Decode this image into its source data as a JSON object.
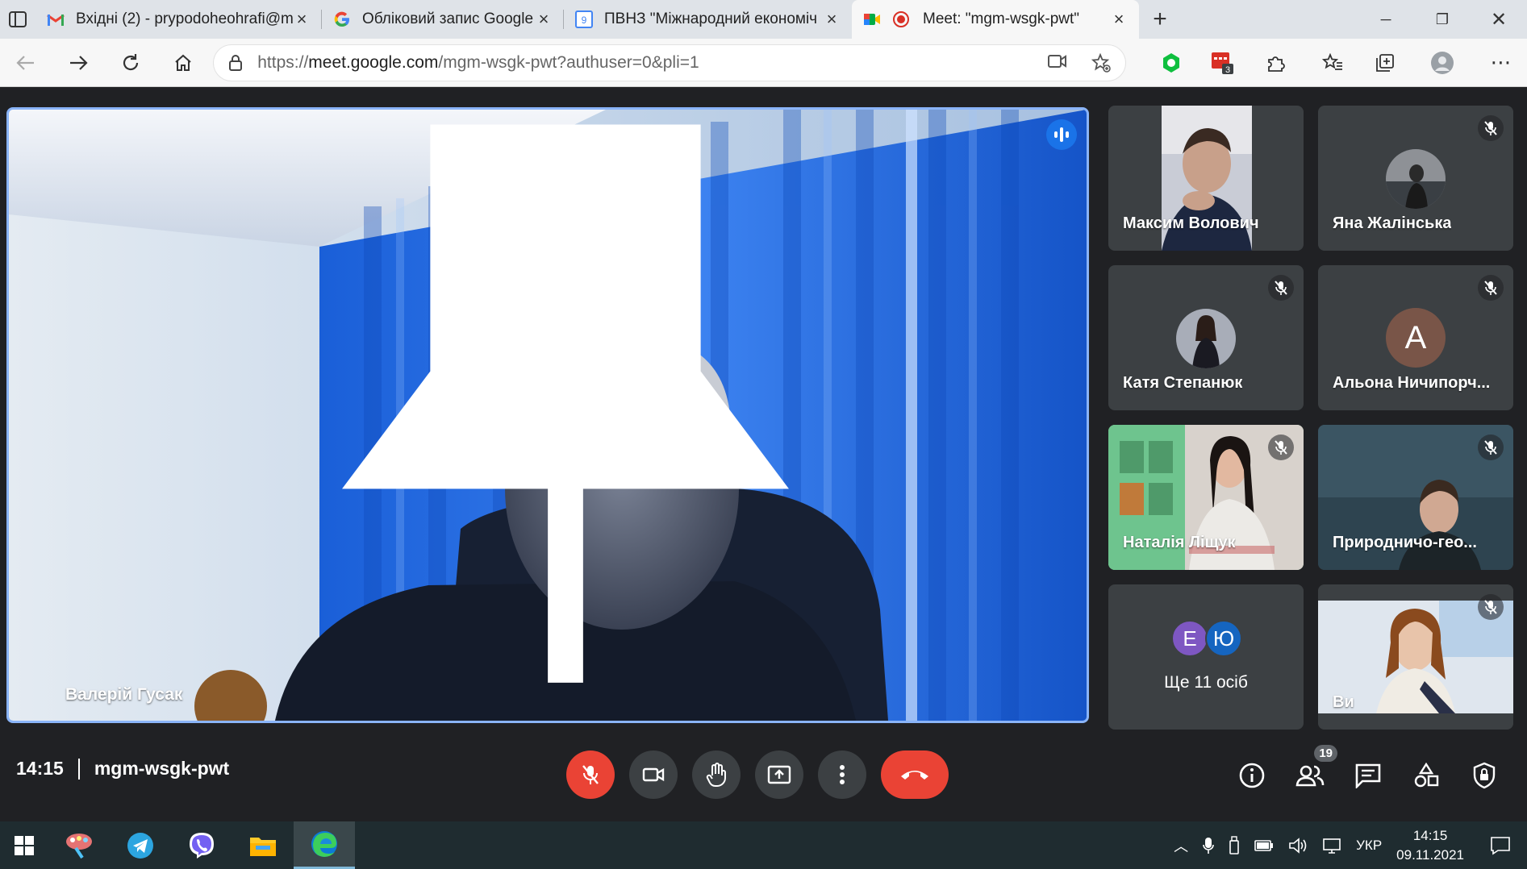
{
  "tabs": [
    {
      "title": "Вхідні (2) - prypodoheohrafi@m",
      "icon": "gmail-icon"
    },
    {
      "title": "Обліковий запис Google",
      "icon": "google-icon"
    },
    {
      "title": "ПВНЗ \"Міжнародний економіч",
      "icon": "calendar-icon"
    },
    {
      "title": "Meet: \"mgm-wsgk-pwt\"",
      "icon": "meet-icon"
    }
  ],
  "address": {
    "scheme": "https://",
    "host": "meet.google.com",
    "path": "/mgm-wsgk-pwt?authuser=0&pli=1"
  },
  "extensions": {
    "badge_count": "3"
  },
  "main_speaker": {
    "name": "Валерій Гусак"
  },
  "participants": [
    {
      "name": "Максим Волович",
      "muted": false
    },
    {
      "name": "Яна Жалінська",
      "muted": true
    },
    {
      "name": "Катя Степанюк",
      "muted": true
    },
    {
      "name": "Альона Ничипорч...",
      "muted": true,
      "initial": "А"
    },
    {
      "name": "Наталія Ліщук",
      "muted": true
    },
    {
      "name": "Природничо-гео...",
      "muted": true
    },
    {
      "name": "Ви",
      "muted": true
    }
  ],
  "more": {
    "initials": [
      "Е",
      "Ю"
    ],
    "text": "Ще 11 осіб",
    "colors": [
      "#7e57c2",
      "#1565c0"
    ]
  },
  "meeting": {
    "time": "14:15",
    "code": "mgm-wsgk-pwt",
    "people_count": "19"
  },
  "taskbar": {
    "lang": "УКР",
    "time": "14:15",
    "date": "09.11.2021"
  },
  "colors": {
    "accent": "#8ab4f8",
    "danger": "#ea4335",
    "meet_bg": "#202124",
    "tile_bg": "#3c4043"
  }
}
